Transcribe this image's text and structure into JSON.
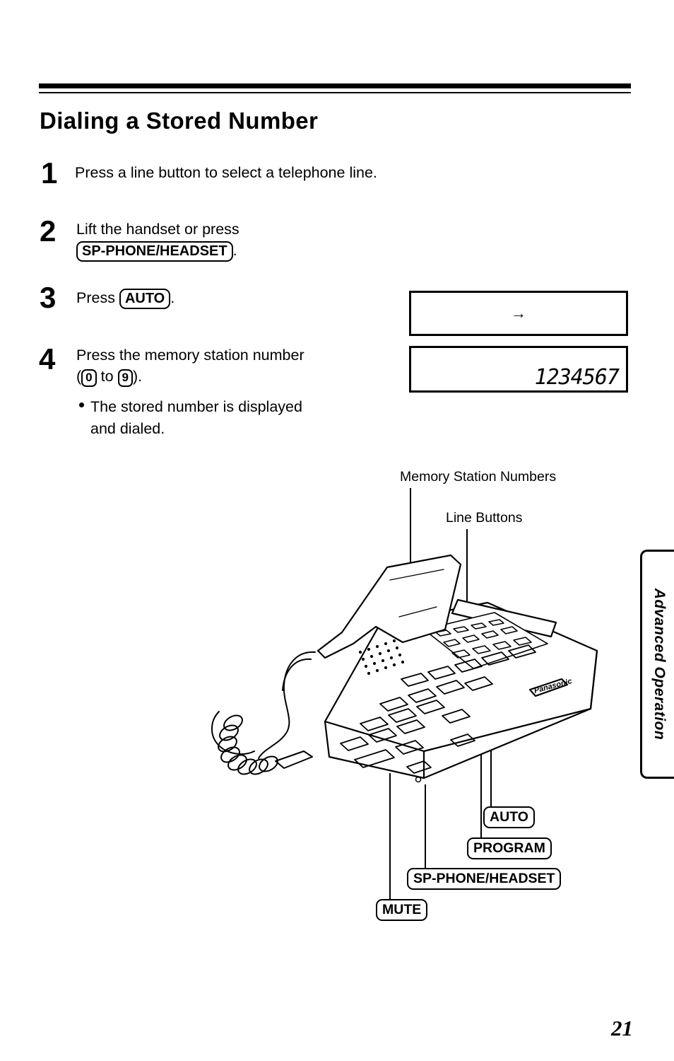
{
  "document": {
    "title": "Dialing a Stored Number",
    "page_number": "21",
    "side_tab_label": "Advanced Operation"
  },
  "steps": [
    {
      "number": "1",
      "text_before": "Press a line button to select a telephone line.",
      "key": "",
      "text_after": ""
    },
    {
      "number": "2",
      "line1": "Lift the handset or press",
      "key": "SP-PHONE/HEADSET",
      "text_after": "."
    },
    {
      "number": "3",
      "text_before": "Press ",
      "key": "AUTO",
      "text_after": "."
    },
    {
      "number": "4",
      "line1": "Press the memory station number",
      "paren_open": "(",
      "key_low": "0",
      "to": " to ",
      "key_high": "9",
      "paren_close": ").",
      "bullet": "The stored number is displayed and dialed.",
      "bullet_line1": "The stored number is displayed",
      "bullet_line2": "and dialed."
    }
  ],
  "display": {
    "top_box_symbol": "→",
    "bottom_box_digits": "1234567"
  },
  "diagram": {
    "callouts": [
      {
        "name": "memory-station-numbers",
        "label": "Memory Station Numbers"
      },
      {
        "name": "line-buttons",
        "label": "Line Buttons"
      }
    ],
    "button_labels": [
      {
        "name": "auto",
        "label": "AUTO"
      },
      {
        "name": "program",
        "label": "PROGRAM"
      },
      {
        "name": "sp-phone-headset",
        "label": "SP-PHONE/HEADSET"
      },
      {
        "name": "mute",
        "label": "MUTE"
      }
    ],
    "phone_brand": "Panasonic"
  }
}
